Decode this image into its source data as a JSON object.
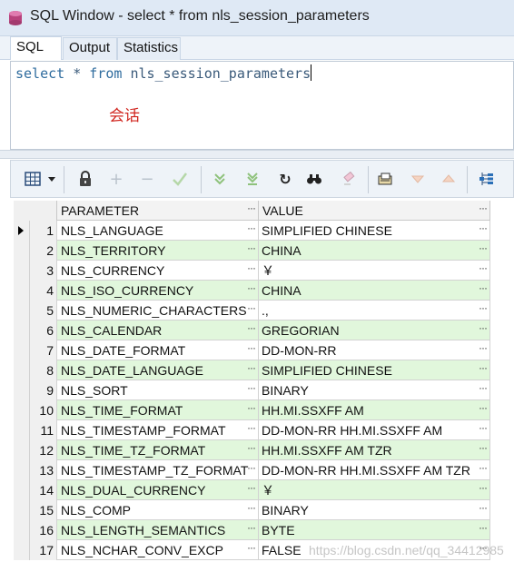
{
  "window": {
    "title": "SQL Window - select * from nls_session_parameters"
  },
  "tabs": [
    {
      "label": "SQL",
      "active": true
    },
    {
      "label": "Output",
      "active": false
    },
    {
      "label": "Statistics",
      "active": false
    }
  ],
  "editor": {
    "kw_select": "select",
    "star": "*",
    "kw_from": "from",
    "table": "nls_session_parameters",
    "annotation": "会话"
  },
  "toolbar": {
    "icons": [
      "grid-layout-icon",
      "dropdown-arrow-icon",
      "lock-icon",
      "add-record-icon",
      "delete-record-icon",
      "post-changes-icon",
      "fetch-next-icon",
      "fetch-last-icon",
      "refresh-icon",
      "find-icon",
      "clear-icon",
      "export-icon",
      "previous-icon",
      "next-icon",
      "tree-view-icon"
    ]
  },
  "grid": {
    "columns": [
      "PARAMETER",
      "VALUE"
    ],
    "cell_button": "···",
    "rows": [
      {
        "num": "1",
        "parameter": "NLS_LANGUAGE",
        "value": "SIMPLIFIED CHINESE"
      },
      {
        "num": "2",
        "parameter": "NLS_TERRITORY",
        "value": "CHINA"
      },
      {
        "num": "3",
        "parameter": "NLS_CURRENCY",
        "value": "￥"
      },
      {
        "num": "4",
        "parameter": "NLS_ISO_CURRENCY",
        "value": "CHINA"
      },
      {
        "num": "5",
        "parameter": "NLS_NUMERIC_CHARACTERS",
        "value": ".,"
      },
      {
        "num": "6",
        "parameter": "NLS_CALENDAR",
        "value": "GREGORIAN"
      },
      {
        "num": "7",
        "parameter": "NLS_DATE_FORMAT",
        "value": "DD-MON-RR"
      },
      {
        "num": "8",
        "parameter": "NLS_DATE_LANGUAGE",
        "value": "SIMPLIFIED CHINESE"
      },
      {
        "num": "9",
        "parameter": "NLS_SORT",
        "value": "BINARY"
      },
      {
        "num": "10",
        "parameter": "NLS_TIME_FORMAT",
        "value": "HH.MI.SSXFF AM"
      },
      {
        "num": "11",
        "parameter": "NLS_TIMESTAMP_FORMAT",
        "value": "DD-MON-RR HH.MI.SSXFF AM"
      },
      {
        "num": "12",
        "parameter": "NLS_TIME_TZ_FORMAT",
        "value": "HH.MI.SSXFF AM TZR"
      },
      {
        "num": "13",
        "parameter": "NLS_TIMESTAMP_TZ_FORMAT",
        "value": "DD-MON-RR HH.MI.SSXFF AM TZR"
      },
      {
        "num": "14",
        "parameter": "NLS_DUAL_CURRENCY",
        "value": "￥"
      },
      {
        "num": "15",
        "parameter": "NLS_COMP",
        "value": "BINARY"
      },
      {
        "num": "16",
        "parameter": "NLS_LENGTH_SEMANTICS",
        "value": "BYTE"
      },
      {
        "num": "17",
        "parameter": "NLS_NCHAR_CONV_EXCP",
        "value": "FALSE"
      }
    ]
  },
  "watermark": "https://blog.csdn.net/qq_34412985",
  "colors": {
    "row_alt": "#e1f7dc",
    "annotation": "#d1261f",
    "keyword": "#2f6c9e"
  }
}
